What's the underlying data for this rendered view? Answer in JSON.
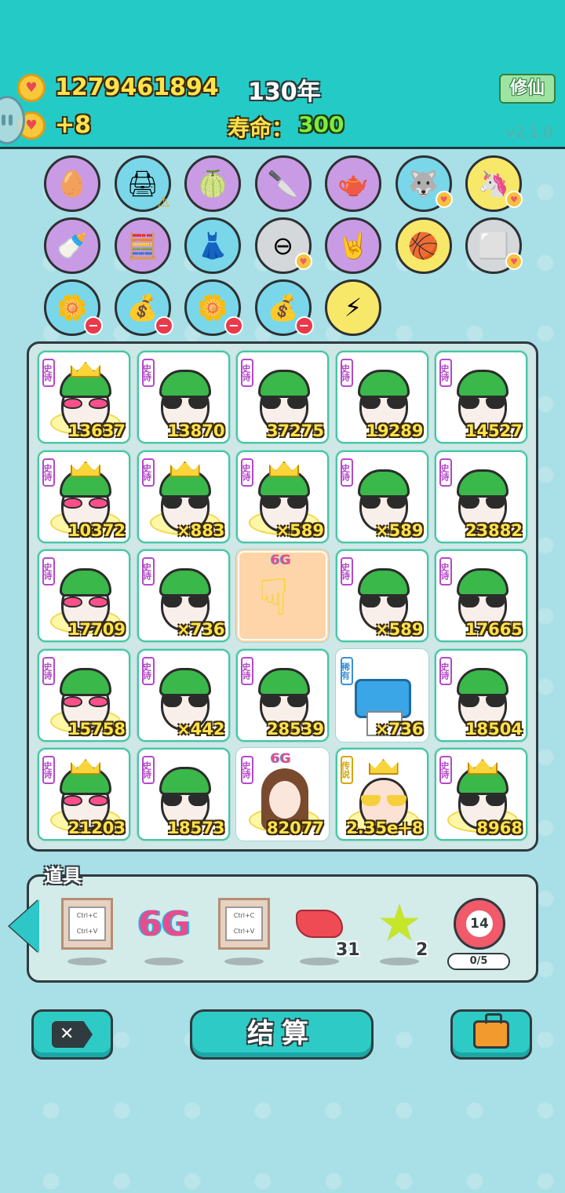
{
  "header": {
    "coins": "1279461894",
    "income": "+8",
    "year": "130年",
    "life_label": "寿命：",
    "life_value": "300",
    "xiuxian_button": "修仙",
    "version": "v2.1.0"
  },
  "attributes": [
    {
      "name": "egg-icon",
      "glyph": "🥚",
      "color": "purple",
      "badge": ""
    },
    {
      "name": "printer-icon",
      "glyph": "🖨",
      "color": "blue",
      "badge": "warn"
    },
    {
      "name": "pomelo-icon",
      "glyph": "🍈",
      "color": "purple",
      "badge": ""
    },
    {
      "name": "cleaver-icon",
      "glyph": "🔪",
      "color": "purple",
      "badge": ""
    },
    {
      "name": "gravy-boat-icon",
      "glyph": "🫖",
      "color": "purple",
      "badge": ""
    },
    {
      "name": "husky-icon",
      "glyph": "🐺",
      "color": "blue",
      "badge": "heart"
    },
    {
      "name": "unicorn-icon",
      "glyph": "🦄",
      "color": "yellow",
      "badge": "heart"
    },
    {
      "name": "breast-pump-icon",
      "glyph": "🍼",
      "color": "purple",
      "badge": ""
    },
    {
      "name": "math-head-icon",
      "glyph": "🧮",
      "color": "purple",
      "badge": ""
    },
    {
      "name": "skirt-icon",
      "glyph": "👗",
      "color": "blue",
      "badge": ""
    },
    {
      "name": "minus-circle-icon",
      "glyph": "⊖",
      "color": "gray",
      "badge": "heart"
    },
    {
      "name": "rock-hand-icon",
      "glyph": "🤘",
      "color": "purple",
      "badge": ""
    },
    {
      "name": "basketballs-icon",
      "glyph": "🏀",
      "color": "yellow",
      "badge": ""
    },
    {
      "name": "tofu-icon",
      "glyph": "⬜",
      "color": "gray",
      "badge": "heart"
    },
    {
      "name": "flower-pot-icon",
      "glyph": "🌼",
      "color": "blue",
      "badge": "minus"
    },
    {
      "name": "rice-bag-icon",
      "glyph": "💰",
      "color": "blue",
      "badge": "minus"
    },
    {
      "name": "flower-pot-icon",
      "glyph": "🌼",
      "color": "blue",
      "badge": "minus"
    },
    {
      "name": "rice-bag-icon",
      "glyph": "💰",
      "color": "blue",
      "badge": "minus"
    },
    {
      "name": "lightning-icon",
      "glyph": "⚡",
      "color": "yellow",
      "badge": ""
    }
  ],
  "board": {
    "cards": [
      {
        "rarity": "史诗",
        "kind": "hero-crown-heart",
        "value": "13637"
      },
      {
        "rarity": "史诗",
        "kind": "hero",
        "value": "13870"
      },
      {
        "rarity": "史诗",
        "kind": "hero",
        "value": "37275"
      },
      {
        "rarity": "史诗",
        "kind": "hero",
        "value": "19289"
      },
      {
        "rarity": "史诗",
        "kind": "hero",
        "value": "14527"
      },
      {
        "rarity": "史诗",
        "kind": "hero-crown-heart",
        "value": "10372"
      },
      {
        "rarity": "史诗",
        "kind": "hero-crown",
        "value": "×883"
      },
      {
        "rarity": "史诗",
        "kind": "hero-crown",
        "value": "×589"
      },
      {
        "rarity": "史诗",
        "kind": "hero",
        "value": "×589"
      },
      {
        "rarity": "史诗",
        "kind": "hero",
        "value": "23882"
      },
      {
        "rarity": "史诗",
        "kind": "hero-heart",
        "value": "17709"
      },
      {
        "rarity": "史诗",
        "kind": "hero",
        "value": "×736"
      },
      {
        "rarity": "",
        "kind": "hand",
        "value": "",
        "tag": "6G"
      },
      {
        "rarity": "史诗",
        "kind": "hero",
        "value": "×589"
      },
      {
        "rarity": "史诗",
        "kind": "hero",
        "value": "17665"
      },
      {
        "rarity": "史诗",
        "kind": "hero-heart",
        "value": "15758"
      },
      {
        "rarity": "史诗",
        "kind": "hero",
        "value": "×442"
      },
      {
        "rarity": "史诗",
        "kind": "hero",
        "value": "28539"
      },
      {
        "rarity": "稀有",
        "kind": "printer",
        "value": "×736"
      },
      {
        "rarity": "史诗",
        "kind": "hero",
        "value": "18504"
      },
      {
        "rarity": "史诗",
        "kind": "hero-crown-heart",
        "value": "21203"
      },
      {
        "rarity": "史诗",
        "kind": "hero",
        "value": "18573"
      },
      {
        "rarity": "史诗",
        "kind": "girl",
        "value": "82077",
        "tag": "6G"
      },
      {
        "rarity": "传说",
        "kind": "oldman",
        "value": "2.35e+8"
      },
      {
        "rarity": "史诗",
        "kind": "hero-crown",
        "value": "8968"
      }
    ]
  },
  "items": {
    "label": "道具",
    "list": [
      {
        "name": "copy-paste-item",
        "kind": "kbd",
        "text": "Ctrl+C Ctrl+V",
        "count": ""
      },
      {
        "name": "6g-item",
        "kind": "sixg",
        "text": "6G",
        "count": ""
      },
      {
        "name": "copy-paste-item",
        "kind": "kbd",
        "text": "Ctrl+C Ctrl+V",
        "count": ""
      },
      {
        "name": "liver-item",
        "kind": "liver",
        "text": "",
        "count": "31"
      },
      {
        "name": "star-item",
        "kind": "star",
        "text": "★",
        "count": "2"
      },
      {
        "name": "target-item",
        "kind": "target",
        "text": "14",
        "count": ""
      }
    ],
    "progress": "0/5"
  },
  "buttons": {
    "close": "✕",
    "settle": "结算"
  }
}
